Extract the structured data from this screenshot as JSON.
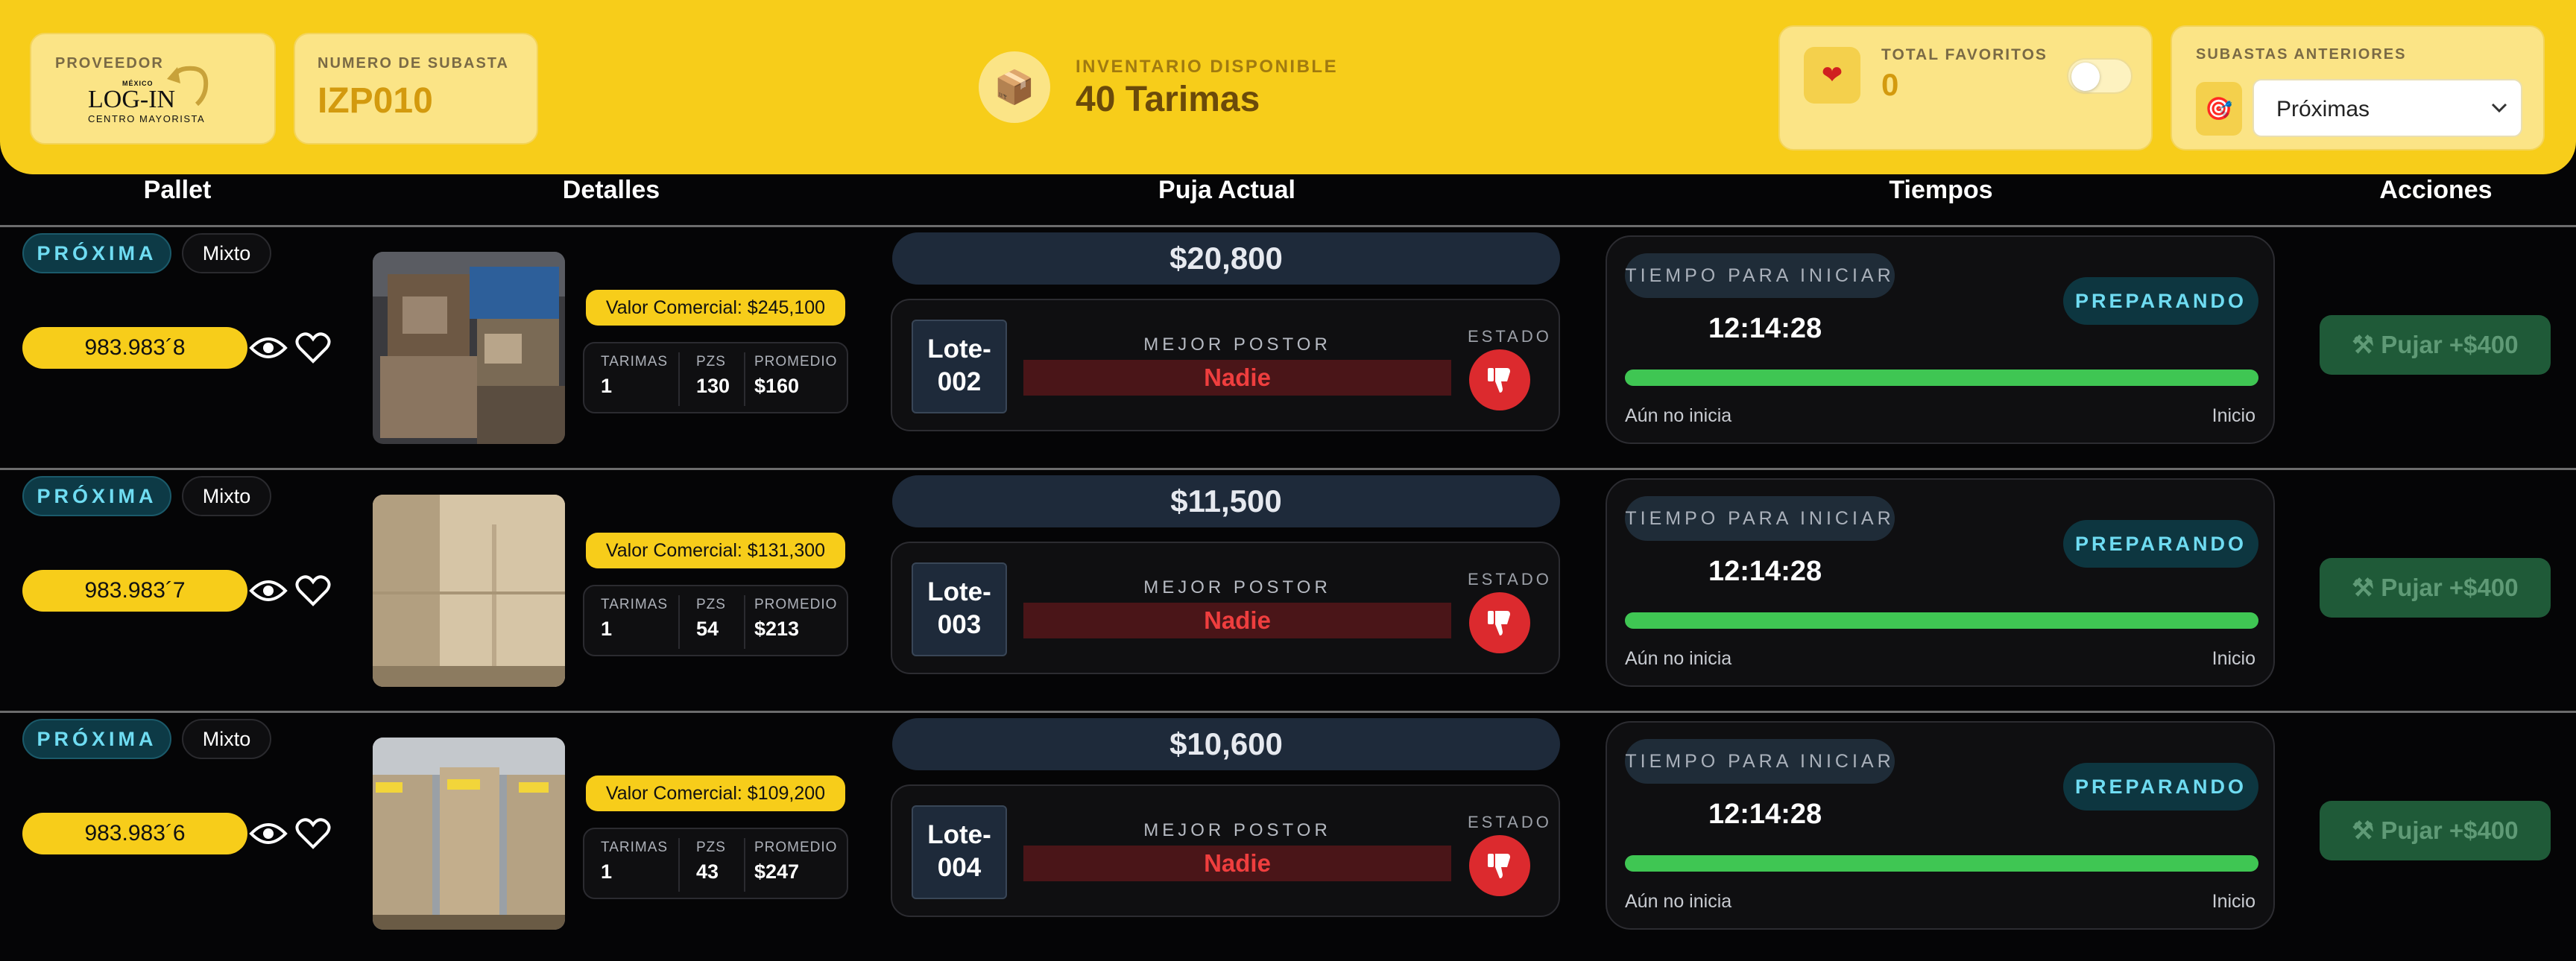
{
  "header": {
    "proveedor_label": "PROVEEDOR",
    "logo": {
      "top": "MÉXICO",
      "name": "LOG-IN",
      "sub": "CENTRO MAYORISTA"
    },
    "subasta_label": "NUMERO DE SUBASTA",
    "subasta_value": "IZP010",
    "inventario_label": "INVENTARIO DISPONIBLE",
    "inventario_value": "40 Tarimas",
    "favoritos_label": "TOTAL FAVORITOS",
    "favoritos_value": "0",
    "anteriores_label": "SUBASTAS ANTERIORES",
    "anteriores_selected": "Próximas",
    "icons": [
      "package-icon",
      "heart-icon",
      "target-icon",
      "chevron-down-icon"
    ]
  },
  "columns": [
    "Pallet",
    "Detalles",
    "Puja Actual",
    "Tiempos",
    "Acciones"
  ],
  "rows": [
    {
      "status": "PRÓXIMA",
      "type": "Mixto",
      "pallet_id": "983.983´8",
      "valor": "Valor Comercial: $245,100",
      "stats": [
        {
          "label": "TARIMAS",
          "value": "1"
        },
        {
          "label": "PZS",
          "value": "130"
        },
        {
          "label": "PROMEDIO",
          "value": "$160"
        }
      ],
      "price": "$20,800",
      "lote": "Lote-002",
      "mejor_postor_label": "MEJOR POSTOR",
      "postor": "Nadie",
      "estado_label": "ESTADO",
      "tiempo_label": "TIEMPO PARA INICIAR",
      "timer": "12:14:28",
      "phase": "PREPARANDO",
      "progress": 1.0,
      "time_left": "Aún no inicia",
      "time_right": "Inicio",
      "action": "Pujar +$400"
    },
    {
      "status": "PRÓXIMA",
      "type": "Mixto",
      "pallet_id": "983.983´7",
      "valor": "Valor Comercial: $131,300",
      "stats": [
        {
          "label": "TARIMAS",
          "value": "1"
        },
        {
          "label": "PZS",
          "value": "54"
        },
        {
          "label": "PROMEDIO",
          "value": "$213"
        }
      ],
      "price": "$11,500",
      "lote": "Lote-003",
      "mejor_postor_label": "MEJOR POSTOR",
      "postor": "Nadie",
      "estado_label": "ESTADO",
      "tiempo_label": "TIEMPO PARA INICIAR",
      "timer": "12:14:28",
      "phase": "PREPARANDO",
      "progress": 1.0,
      "time_left": "Aún no inicia",
      "time_right": "Inicio",
      "action": "Pujar +$400"
    },
    {
      "status": "PRÓXIMA",
      "type": "Mixto",
      "pallet_id": "983.983´6",
      "valor": "Valor Comercial: $109,200",
      "stats": [
        {
          "label": "TARIMAS",
          "value": "1"
        },
        {
          "label": "PZS",
          "value": "43"
        },
        {
          "label": "PROMEDIO",
          "value": "$247"
        }
      ],
      "price": "$10,600",
      "lote": "Lote-004",
      "mejor_postor_label": "MEJOR POSTOR",
      "postor": "Nadie",
      "estado_label": "ESTADO",
      "tiempo_label": "TIEMPO PARA INICIAR",
      "timer": "12:14:28",
      "phase": "PREPARANDO",
      "progress": 1.0,
      "time_left": "Aún no inicia",
      "time_right": "Inicio",
      "action": "Pujar +$400"
    }
  ],
  "colors": {
    "brand_yellow": "#f7cd1a",
    "status_cyan": "#6fdcf2",
    "progress_green": "#3fc653",
    "danger_red": "#dc2a2e"
  }
}
